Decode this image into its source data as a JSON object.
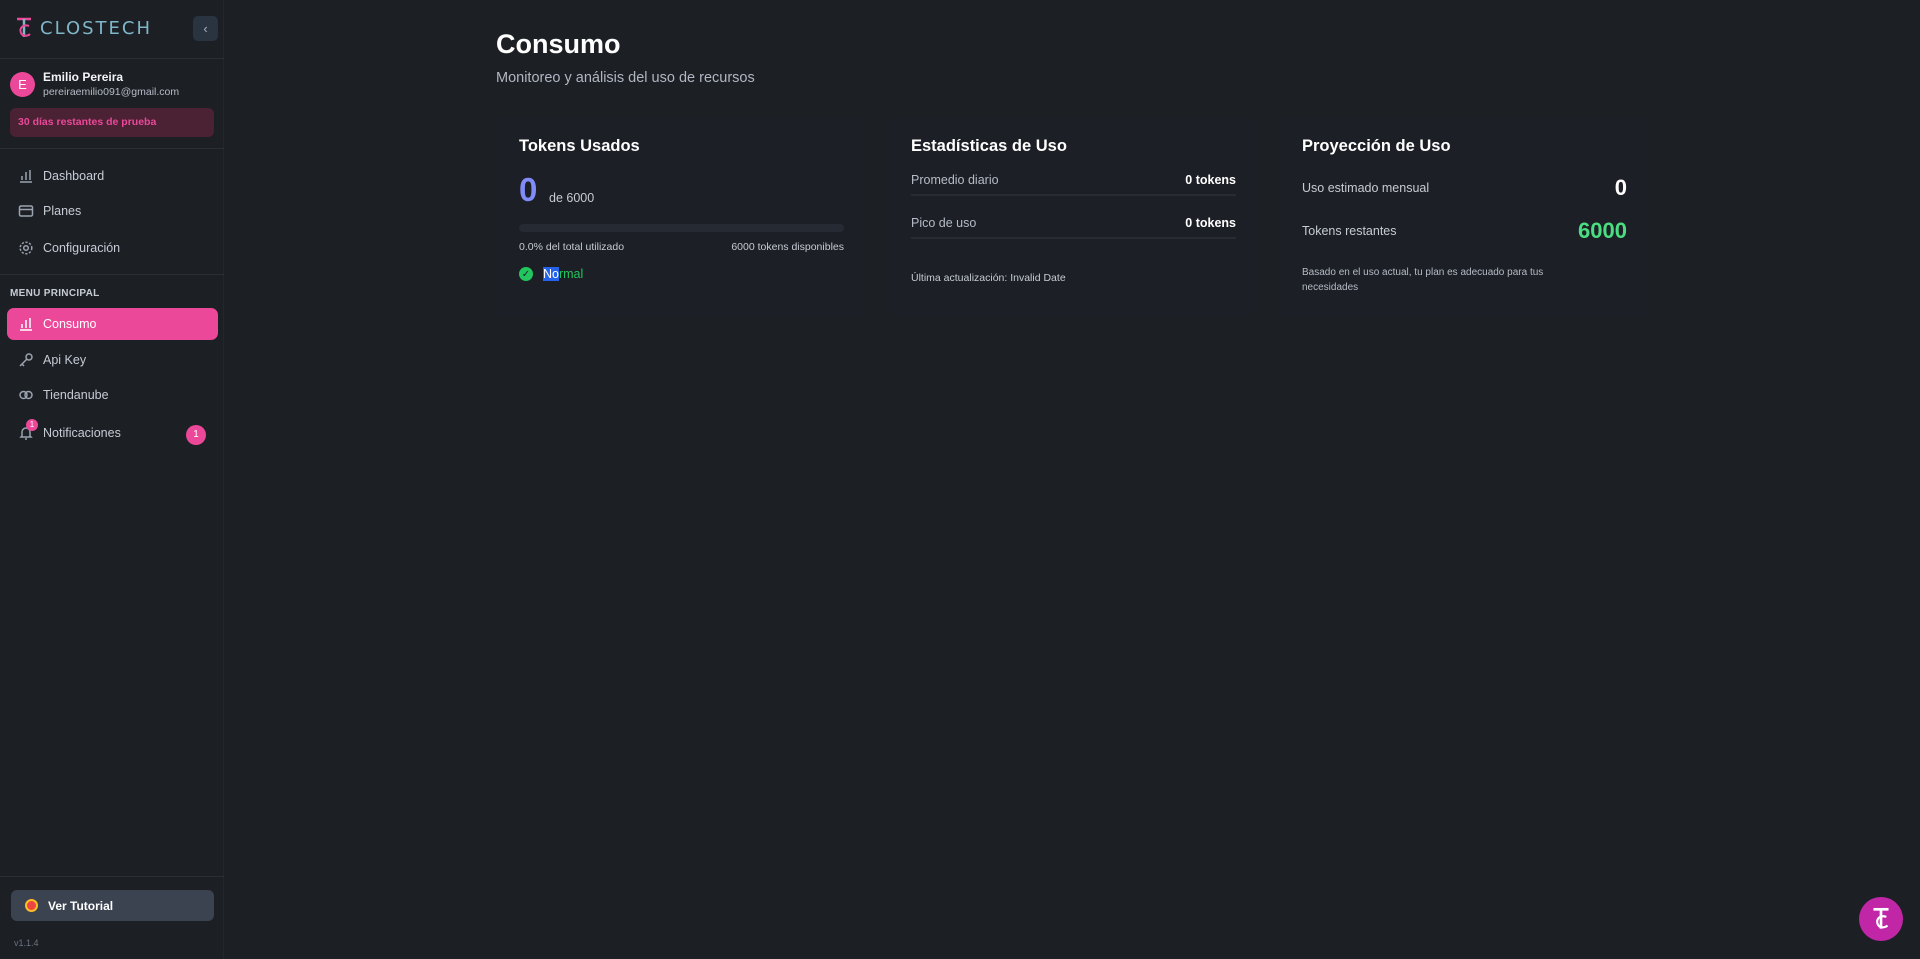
{
  "brand": {
    "name": "CLOSTECH"
  },
  "user": {
    "initial": "E",
    "name": "Emilio Pereira",
    "email": "pereiraemilio091@gmail.com",
    "trial": "30 días restantes de prueba"
  },
  "nav": {
    "top": [
      {
        "label": "Dashboard",
        "icon": "bar-chart-icon"
      },
      {
        "label": "Planes",
        "icon": "credit-card-icon"
      },
      {
        "label": "Configuración",
        "icon": "gear-icon"
      }
    ],
    "section_title": "MENU PRINCIPAL",
    "main": [
      {
        "label": "Consumo",
        "icon": "bar-chart-icon",
        "active": true
      },
      {
        "label": "Api Key",
        "icon": "key-icon"
      },
      {
        "label": "Tiendanube",
        "icon": "cloud-icon"
      },
      {
        "label": "Notificaciones",
        "icon": "bell-icon",
        "badge": "1"
      }
    ]
  },
  "tutorial": {
    "label": "Ver Tutorial"
  },
  "version": "v1.1.4",
  "page": {
    "title": "Consumo",
    "subtitle": "Monitoreo y análisis del uso de recursos"
  },
  "tokens_card": {
    "title": "Tokens Usados",
    "used": "0",
    "of_total": "de 6000",
    "progress_fraction": 0,
    "percent_text": "0.0% del total utilizado",
    "available_text": "6000 tokens disponibles",
    "status_highlight": "No",
    "status_rest": "rmal"
  },
  "stats_card": {
    "title": "Estadísticas de Uso",
    "rows": [
      {
        "label": "Promedio diario",
        "value": "0 tokens"
      },
      {
        "label": "Pico de uso",
        "value": "0 tokens"
      }
    ],
    "updated": "Última actualización: Invalid Date"
  },
  "projection_card": {
    "title": "Proyección de Uso",
    "monthly_label": "Uso estimado mensual",
    "monthly_value": "0",
    "remaining_label": "Tokens restantes",
    "remaining_value": "6000",
    "note": "Basado en el uso actual, tu plan es adecuado para tus necesidades"
  },
  "colors": {
    "accent": "#ec4899",
    "indigo": "#818cf8",
    "success": "#22c55e",
    "background": "#1c1f24"
  }
}
